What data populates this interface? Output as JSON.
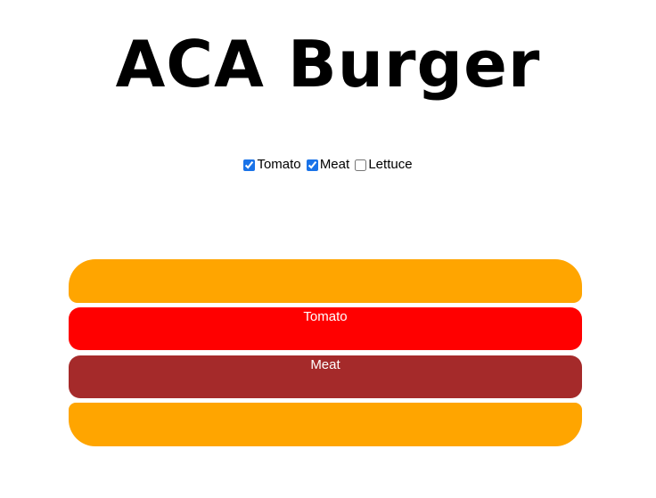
{
  "title": "ACA Burger",
  "toppings": [
    {
      "label": "Tomato",
      "checked": true
    },
    {
      "label": "Meat",
      "checked": true
    },
    {
      "label": "Lettuce",
      "checked": false
    }
  ],
  "burger": {
    "layers": [
      {
        "label": ""
      },
      {
        "label": "Tomato"
      },
      {
        "label": "Meat"
      },
      {
        "label": ""
      }
    ]
  },
  "colors": {
    "bun": "#ffa500",
    "tomato": "#ff0000",
    "meat": "#a52a2a",
    "checkbox_accent": "#1a73e8"
  }
}
